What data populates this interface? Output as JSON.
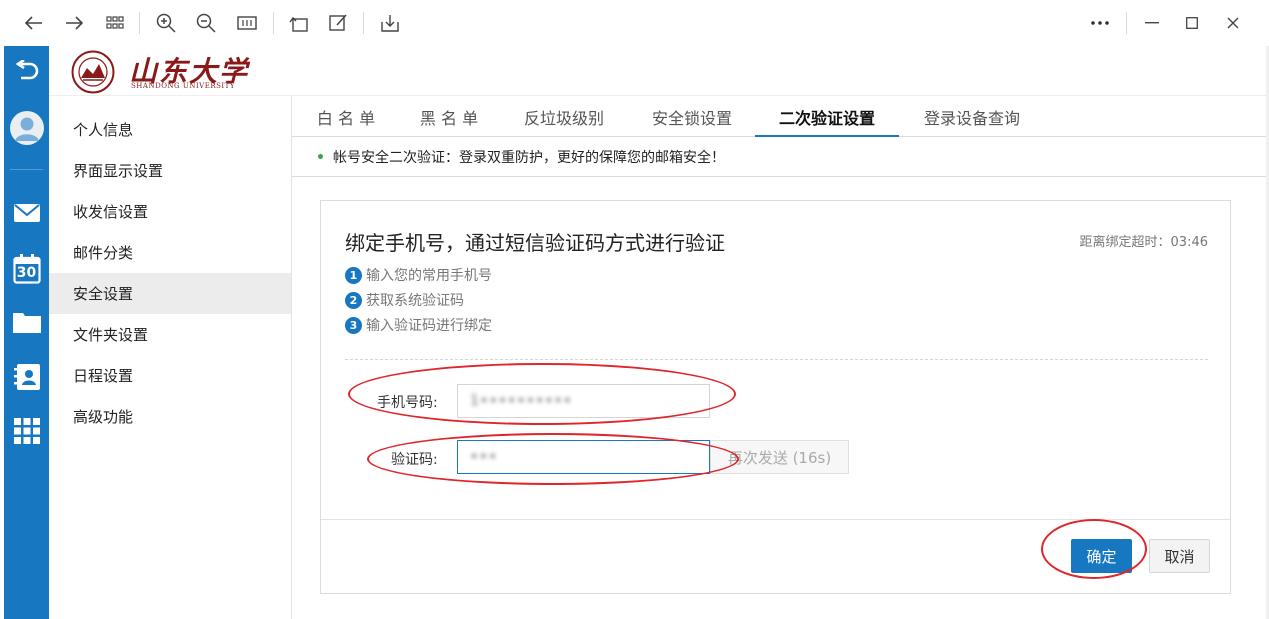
{
  "toolbar": {
    "buttons": [
      "back-arrow-icon",
      "forward-arrow-icon",
      "grid-view-icon",
      "zoom-in-icon",
      "zoom-out-icon",
      "fit-page-icon",
      "rotate-icon",
      "edit-icon",
      "download-icon"
    ],
    "window_buttons": [
      "more-icon",
      "minimize-icon",
      "maximize-icon",
      "close-icon"
    ]
  },
  "rail": {
    "icons": [
      "back-icon",
      "avatar-icon",
      "mail-icon",
      "calendar-icon",
      "folder-icon",
      "contacts-icon",
      "apps-grid-icon"
    ],
    "calendar_day": "30"
  },
  "header": {
    "logo_text": "山东大学",
    "logo_subtext": "SHANDONG UNIVERSITY"
  },
  "menu": {
    "items": [
      {
        "label": "个人信息"
      },
      {
        "label": "界面显示设置"
      },
      {
        "label": "收发信设置"
      },
      {
        "label": "邮件分类"
      },
      {
        "label": "安全设置"
      },
      {
        "label": "文件夹设置"
      },
      {
        "label": "日程设置"
      },
      {
        "label": "高级功能"
      }
    ],
    "active_index": 4
  },
  "tabs": [
    {
      "label": "白 名 单"
    },
    {
      "label": "黑 名 单"
    },
    {
      "label": "反垃圾级别"
    },
    {
      "label": "安全锁设置"
    },
    {
      "label": "二次验证设置"
    },
    {
      "label": "登录设备查询"
    }
  ],
  "notice": "帐号安全二次验证：登录双重防护，更好的保障您的邮箱安全！",
  "card": {
    "title": "绑定手机号，通过短信验证码方式进行验证",
    "timer": "距离绑定超时：03:46",
    "steps": [
      {
        "num": "1",
        "text": "输入您的常用手机号"
      },
      {
        "num": "2",
        "text": "获取系统验证码"
      },
      {
        "num": "3",
        "text": "输入验证码进行绑定"
      }
    ],
    "phone_label": "手机号码:",
    "phone_value": "1••••••••••",
    "code_label": "验证码:",
    "code_value": "•••",
    "resend_label": "再次发送 (16s)",
    "confirm_label": "确定",
    "cancel_label": "取消"
  },
  "colors": {
    "brand_blue": "#1777c1",
    "annotation_red": "#e0262a",
    "logo_red": "#8a1a1a"
  }
}
